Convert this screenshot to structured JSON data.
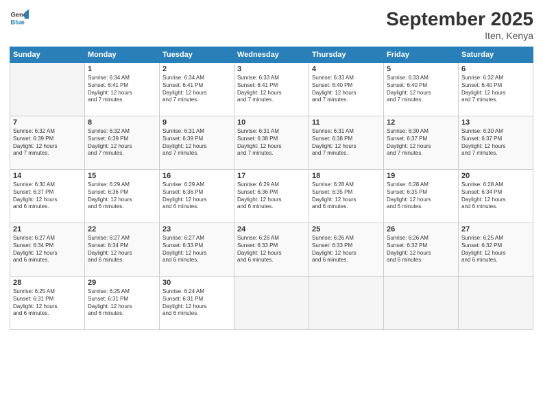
{
  "header": {
    "logo_line1": "General",
    "logo_line2": "Blue",
    "title": "September 2025",
    "location": "Iten, Kenya"
  },
  "days_of_week": [
    "Sunday",
    "Monday",
    "Tuesday",
    "Wednesday",
    "Thursday",
    "Friday",
    "Saturday"
  ],
  "weeks": [
    [
      {
        "day": "",
        "content": ""
      },
      {
        "day": "1",
        "content": "Sunrise: 6:34 AM\nSunset: 6:41 PM\nDaylight: 12 hours\nand 7 minutes."
      },
      {
        "day": "2",
        "content": "Sunrise: 6:34 AM\nSunset: 6:41 PM\nDaylight: 12 hours\nand 7 minutes."
      },
      {
        "day": "3",
        "content": "Sunrise: 6:33 AM\nSunset: 6:41 PM\nDaylight: 12 hours\nand 7 minutes."
      },
      {
        "day": "4",
        "content": "Sunrise: 6:33 AM\nSunset: 6:40 PM\nDaylight: 12 hours\nand 7 minutes."
      },
      {
        "day": "5",
        "content": "Sunrise: 6:33 AM\nSunset: 6:40 PM\nDaylight: 12 hours\nand 7 minutes."
      },
      {
        "day": "6",
        "content": "Sunrise: 6:32 AM\nSunset: 6:40 PM\nDaylight: 12 hours\nand 7 minutes."
      }
    ],
    [
      {
        "day": "7",
        "content": "Sunrise: 6:32 AM\nSunset: 6:39 PM\nDaylight: 12 hours\nand 7 minutes."
      },
      {
        "day": "8",
        "content": "Sunrise: 6:32 AM\nSunset: 6:39 PM\nDaylight: 12 hours\nand 7 minutes."
      },
      {
        "day": "9",
        "content": "Sunrise: 6:31 AM\nSunset: 6:39 PM\nDaylight: 12 hours\nand 7 minutes."
      },
      {
        "day": "10",
        "content": "Sunrise: 6:31 AM\nSunset: 6:38 PM\nDaylight: 12 hours\nand 7 minutes."
      },
      {
        "day": "11",
        "content": "Sunrise: 6:31 AM\nSunset: 6:38 PM\nDaylight: 12 hours\nand 7 minutes."
      },
      {
        "day": "12",
        "content": "Sunrise: 6:30 AM\nSunset: 6:37 PM\nDaylight: 12 hours\nand 7 minutes."
      },
      {
        "day": "13",
        "content": "Sunrise: 6:30 AM\nSunset: 6:37 PM\nDaylight: 12 hours\nand 7 minutes."
      }
    ],
    [
      {
        "day": "14",
        "content": "Sunrise: 6:30 AM\nSunset: 6:37 PM\nDaylight: 12 hours\nand 6 minutes."
      },
      {
        "day": "15",
        "content": "Sunrise: 6:29 AM\nSunset: 6:36 PM\nDaylight: 12 hours\nand 6 minutes."
      },
      {
        "day": "16",
        "content": "Sunrise: 6:29 AM\nSunset: 6:36 PM\nDaylight: 12 hours\nand 6 minutes."
      },
      {
        "day": "17",
        "content": "Sunrise: 6:29 AM\nSunset: 6:36 PM\nDaylight: 12 hours\nand 6 minutes."
      },
      {
        "day": "18",
        "content": "Sunrise: 6:28 AM\nSunset: 6:35 PM\nDaylight: 12 hours\nand 6 minutes."
      },
      {
        "day": "19",
        "content": "Sunrise: 6:28 AM\nSunset: 6:35 PM\nDaylight: 12 hours\nand 6 minutes."
      },
      {
        "day": "20",
        "content": "Sunrise: 6:28 AM\nSunset: 6:34 PM\nDaylight: 12 hours\nand 6 minutes."
      }
    ],
    [
      {
        "day": "21",
        "content": "Sunrise: 6:27 AM\nSunset: 6:34 PM\nDaylight: 12 hours\nand 6 minutes."
      },
      {
        "day": "22",
        "content": "Sunrise: 6:27 AM\nSunset: 6:34 PM\nDaylight: 12 hours\nand 6 minutes."
      },
      {
        "day": "23",
        "content": "Sunrise: 6:27 AM\nSunset: 6:33 PM\nDaylight: 12 hours\nand 6 minutes."
      },
      {
        "day": "24",
        "content": "Sunrise: 6:26 AM\nSunset: 6:33 PM\nDaylight: 12 hours\nand 6 minutes."
      },
      {
        "day": "25",
        "content": "Sunrise: 6:26 AM\nSunset: 6:33 PM\nDaylight: 12 hours\nand 6 minutes."
      },
      {
        "day": "26",
        "content": "Sunrise: 6:26 AM\nSunset: 6:32 PM\nDaylight: 12 hours\nand 6 minutes."
      },
      {
        "day": "27",
        "content": "Sunrise: 6:25 AM\nSunset: 6:32 PM\nDaylight: 12 hours\nand 6 minutes."
      }
    ],
    [
      {
        "day": "28",
        "content": "Sunrise: 6:25 AM\nSunset: 6:31 PM\nDaylight: 12 hours\nand 6 minutes."
      },
      {
        "day": "29",
        "content": "Sunrise: 6:25 AM\nSunset: 6:31 PM\nDaylight: 12 hours\nand 6 minutes."
      },
      {
        "day": "30",
        "content": "Sunrise: 6:24 AM\nSunset: 6:31 PM\nDaylight: 12 hours\nand 6 minutes."
      },
      {
        "day": "",
        "content": ""
      },
      {
        "day": "",
        "content": ""
      },
      {
        "day": "",
        "content": ""
      },
      {
        "day": "",
        "content": ""
      }
    ]
  ]
}
